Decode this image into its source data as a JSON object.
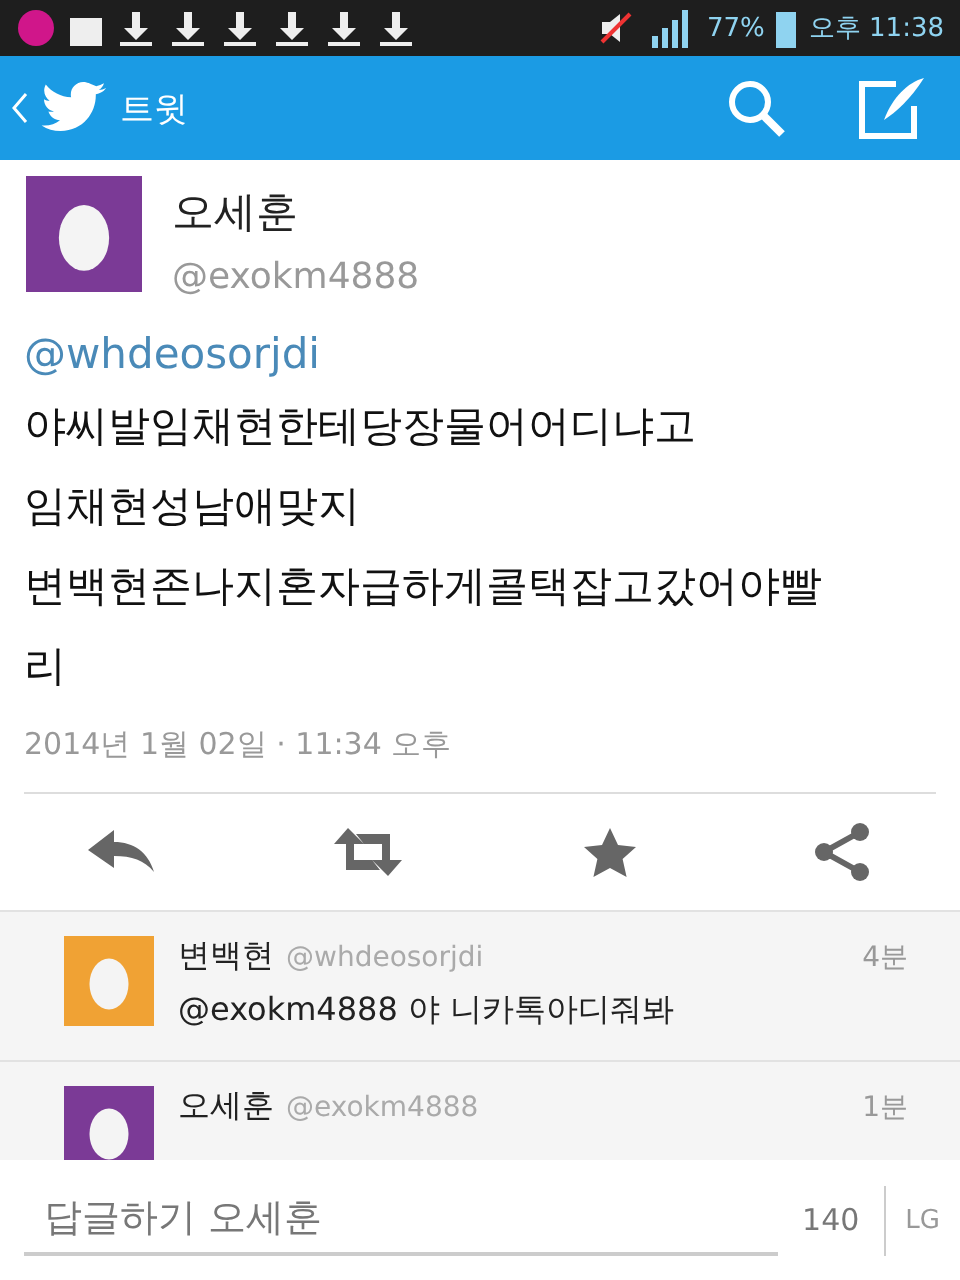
{
  "status_bar": {
    "battery": "77%",
    "time": "오후 11:38"
  },
  "header": {
    "title": "트윗"
  },
  "tweet": {
    "name": "오세훈",
    "handle": "@exokm4888",
    "mention": "@whdeosorjdi",
    "lines": [
      "야씨발임채현한테당장물어어디냐고",
      "임채현성남애맞지",
      "변백현존나지혼자급하게콜택잡고갔어야빨",
      "리"
    ],
    "timestamp": "2014년 1월 02일 · 11:34 오후"
  },
  "replies": [
    {
      "name": "변백현",
      "handle": "@whdeosorjdi",
      "time": "4분",
      "text": "@exokm4888 야 니카톡아디줘봐",
      "color": "#f0a234"
    },
    {
      "name": "오세훈",
      "handle": "@exokm4888",
      "time": "1분",
      "color": "#7b3a96"
    }
  ],
  "reply_bar": {
    "placeholder": "답글하기 오세훈",
    "count": "140",
    "keyboard": "LG"
  }
}
